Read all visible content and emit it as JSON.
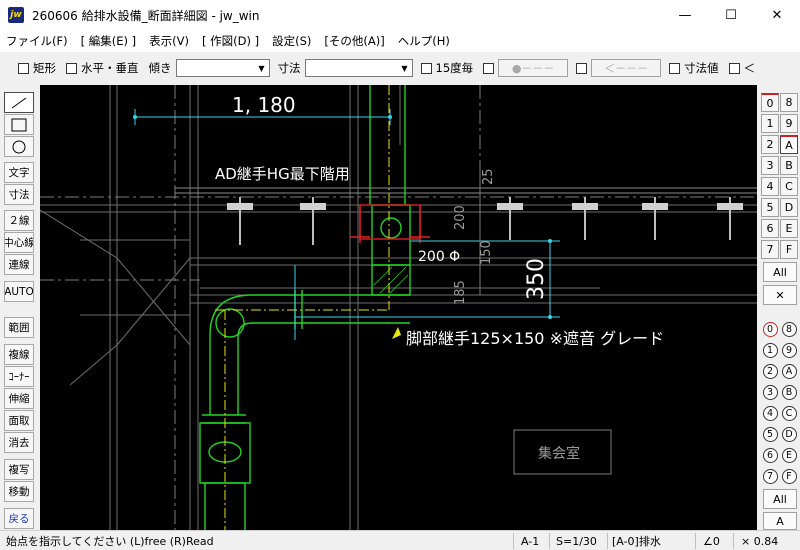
{
  "window": {
    "icon_text": "jw",
    "title": "260606 給排水設備_断面詳細図 - jw_win",
    "minimize": "—",
    "maximize": "☐",
    "close": "✕"
  },
  "menu": [
    "ファイル(F)",
    "[ 編集(E) ]",
    "表示(V)",
    "[ 作図(D) ]",
    "設定(S)",
    "[その他(A)]",
    "ヘルプ(H)"
  ],
  "toolbar": {
    "rect": "矩形",
    "horiz_vert": "水平・垂直",
    "tilt": "傾き",
    "dimension": "寸法",
    "deg15": "15度毎",
    "dot_line": "●－－－",
    "arrow_line": "＜－－－",
    "dim_value": "寸法値",
    "lt": "＜"
  },
  "left_tools": [
    {
      "name": "line",
      "label": ""
    },
    {
      "name": "rect",
      "label": ""
    },
    {
      "name": "circle",
      "label": ""
    },
    {
      "name": "text",
      "label": "文字"
    },
    {
      "name": "dimension",
      "label": "寸法"
    },
    {
      "name": "double-line",
      "label": "２線"
    },
    {
      "name": "center-line",
      "label": "中心線"
    },
    {
      "name": "continuous-line",
      "label": "連線"
    },
    {
      "name": "auto",
      "label": "AUTO"
    },
    {
      "name": "range",
      "label": "範囲"
    },
    {
      "name": "compound-line",
      "label": "複線"
    },
    {
      "name": "corner",
      "label": "ｺｰﾅｰ"
    },
    {
      "name": "stretch",
      "label": "伸縮"
    },
    {
      "name": "chamfer",
      "label": "面取"
    },
    {
      "name": "erase",
      "label": "消去"
    },
    {
      "name": "copy",
      "label": "複写"
    },
    {
      "name": "move",
      "label": "移動"
    },
    {
      "name": "undo",
      "label": "戻る"
    }
  ],
  "drawing": {
    "dim_top": "1, 180",
    "label_ad": "AD継手HG最下階用",
    "label_phi": "200 Φ",
    "dim_200": "200",
    "dim_150": "150",
    "dim_185": "185",
    "dim_25": "25",
    "dim_350": "350",
    "label_leg": "脚部継手125×150  ※遮音 グレード",
    "room": "集会室"
  },
  "layer_groups": {
    "numbers_left": [
      "0",
      "1",
      "2",
      "3",
      "4",
      "5",
      "6",
      "7"
    ],
    "letters_right": [
      "8",
      "9",
      "A",
      "B",
      "C",
      "D",
      "E",
      "F"
    ],
    "all": "All",
    "x": "✕"
  },
  "layers": {
    "left": [
      "0",
      "1",
      "2",
      "3",
      "4",
      "5",
      "6",
      "7"
    ],
    "right": [
      "8",
      "9",
      "A",
      "B",
      "C",
      "D",
      "E",
      "F"
    ],
    "all": "All",
    "a": "A"
  },
  "status": {
    "message": "始点を指示してください (L)free (R)Read",
    "grid": "A-1",
    "scale": "S=1/30",
    "layer": "[A-0]排水",
    "angle": "∠0",
    "zoom": "× 0.84"
  }
}
